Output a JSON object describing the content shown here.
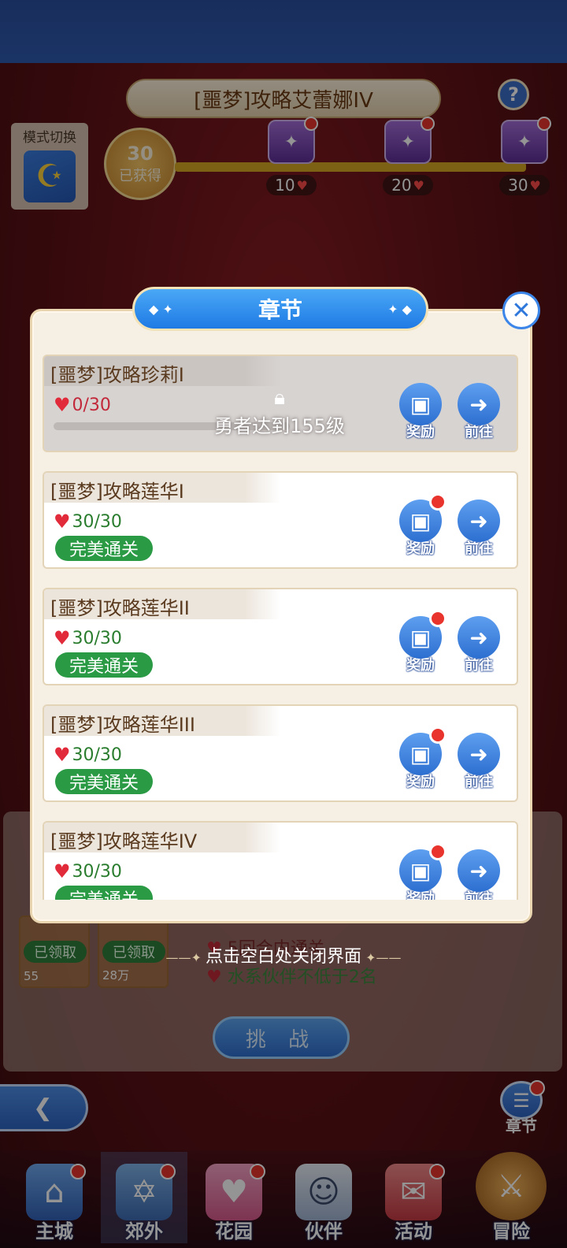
{
  "scene": {
    "title": "[噩梦]攻略艾蕾娜IV",
    "help": "?",
    "mode_switch_label": "模式切换",
    "hearts_badge_value": "30",
    "hearts_badge_label": "已获得",
    "chests": [
      {
        "value": "10"
      },
      {
        "value": "20"
      },
      {
        "value": "30"
      }
    ],
    "slots": [
      {
        "status": "已领取",
        "amount": "55"
      },
      {
        "status": "已领取",
        "amount": "28万"
      }
    ],
    "conditions": [
      "5回合内通关",
      "水系伙伴不低于2名"
    ],
    "challenge_label": "挑 战",
    "chapter_label": "章节"
  },
  "hint": "点击空白处关闭界面",
  "modal": {
    "title": "章节",
    "close": "✕",
    "cards": [
      {
        "name": "[噩梦]攻略珍莉I",
        "progress": "0/30",
        "locked": true,
        "lock_text": "勇者达到155级",
        "reward": "奖励",
        "goto": "前往"
      },
      {
        "name": "[噩梦]攻略莲华I",
        "progress": "30/30",
        "badge": "完美通关",
        "reward": "奖励",
        "goto": "前往"
      },
      {
        "name": "[噩梦]攻略莲华II",
        "progress": "30/30",
        "badge": "完美通关",
        "reward": "奖励",
        "goto": "前往"
      },
      {
        "name": "[噩梦]攻略莲华III",
        "progress": "30/30",
        "badge": "完美通关",
        "reward": "奖励",
        "goto": "前往"
      },
      {
        "name": "[噩梦]攻略莲华IV",
        "progress": "30/30",
        "badge": "完美通关",
        "reward": "奖励",
        "goto": "前往"
      }
    ]
  },
  "nav": [
    {
      "label": "主城",
      "icon": "castle-icon"
    },
    {
      "label": "郊外",
      "icon": "magic-circle-icon"
    },
    {
      "label": "花园",
      "icon": "heart-icon"
    },
    {
      "label": "伙伴",
      "icon": "partner-portrait-icon"
    },
    {
      "label": "活动",
      "icon": "gift-icon"
    },
    {
      "label": "冒险",
      "icon": "sword-icon"
    }
  ],
  "colors": {
    "accent_blue": "#2f7ae4",
    "perfect_green": "#2a9a45",
    "heart_red": "#e12b3a",
    "notice_red": "#e8342c"
  }
}
